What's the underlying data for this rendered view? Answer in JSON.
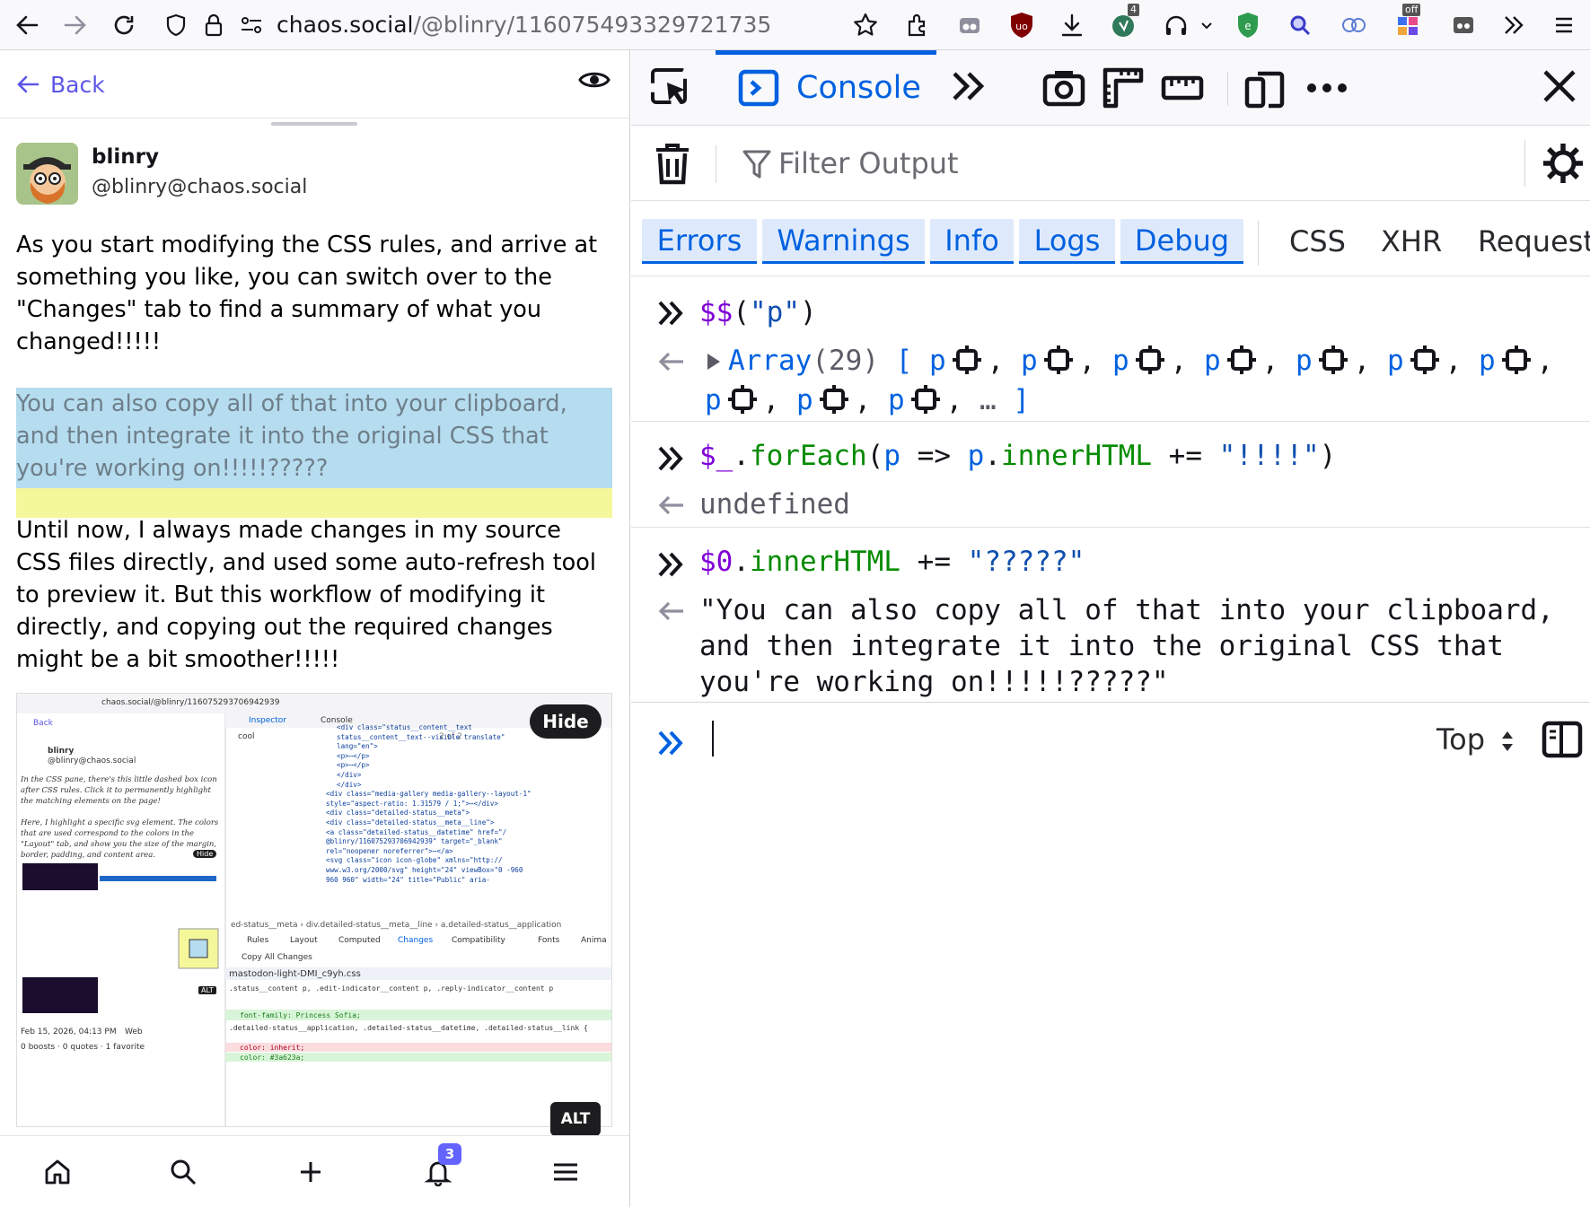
{
  "browser": {
    "url_host": "chaos.social",
    "url_path": "/@blinry/116075493329721735",
    "ext_badge_count": "4",
    "ext_badge_off": "off"
  },
  "page": {
    "back_label": "Back",
    "author": {
      "name": "blinry",
      "handle": "@blinry@chaos.social"
    },
    "paragraphs": [
      "As you start modifying the CSS rules, and arrive at something you like, you can switch over to the \"Changes\" tab to find a summary of what you changed!!!!!",
      "You can also copy all of that into your clipboard, and then integrate it into the original CSS that you're working on!!!!!?????",
      "Until now, I always made changes in my source CSS files directly, and used some auto-refresh tool to preview it. But this workflow of modifying it directly, and copying out the required changes might be a bit smoother!!!!!"
    ],
    "media": {
      "hide_label": "Hide",
      "alt_label": "ALT",
      "thumb": {
        "url": "chaos.social/@blinry/116075293706942939",
        "back": "Back",
        "author": "blinry",
        "handle": "@blinry@chaos.social",
        "p1": "In the CSS pane, there's this little dashed box icon after CSS rules. Click it to permanently highlight the matching elements on the page!",
        "p2": "Here, I highlight a specific svg element. The colors that are used correspond to the colors in the \"Layout\" tab, and show you the size of the margin, border, padding, and content area.",
        "tab_inspector": "Inspector",
        "tab_console": "Console",
        "search": "cool",
        "search_count": "2 of 2",
        "code_lines": [
          "<div class=\"status__content__text",
          "status__content__text--visible translate\"",
          "lang=\"en\">",
          "<p>⋯</p>",
          "<p>⋯</p>",
          "</div>",
          "</div>",
          "<div class=\"media-gallery media-gallery--layout-1\"",
          "style=\"aspect-ratio: 1.31579 / 1;\">⋯</div>",
          "<div class=\"detailed-status__meta\">",
          "<div class=\"detailed-status__meta__line\">",
          "<a class=\"detailed-status__datetime\" href=\"/",
          "@blinry/116075293706942939\" target=\"_blank\"",
          "rel=\"noopener noreferrer\">⋯</a>",
          "<svg class=\"icon icon-globe\" xmlns=\"http://",
          "www.w3.org/2000/svg\" height=\"24\" viewBox=\"0 -960",
          "960 960\" width=\"24\" title=\"Public\" aria-"
        ],
        "breadcrumb": "ed-status__meta  › div.detailed-status__meta__line  › a.detailed-status__application",
        "sub_tabs": [
          "Rules",
          "Layout",
          "Computed",
          "Changes",
          "Compatibility",
          "Fonts",
          "Anima"
        ],
        "copy_all": "Copy All Changes",
        "file": "mastodon-light-DMI_c9yh.css",
        "diff1_sel": ".status__content p, .edit-indicator__content p, .reply-indicator__content p",
        "diff1_add": "font-family: Princess Sofia;",
        "diff2_sel": ".detailed-status__application, .detailed-status__datetime, .detailed-status__link {",
        "diff2_del": "color: inherit;",
        "diff2_add": "color: #3a623a;",
        "date": "Feb 15, 2026, 04:13 PM",
        "visibility": "Web",
        "stats": "0 boosts · 0 quotes · 1 favorite",
        "hide": "Hide",
        "alt": "ALT"
      }
    },
    "nav": {
      "notif_count": "3"
    }
  },
  "devtools": {
    "active_tab": "Console",
    "filter_placeholder": "Filter Output",
    "levels": [
      "Errors",
      "Warnings",
      "Info",
      "Logs",
      "Debug"
    ],
    "categories": [
      "CSS",
      "XHR",
      "Request"
    ],
    "context": "Top",
    "entries": {
      "in1_fn": "$$",
      "in1_arg": "\"p\"",
      "out1_label": "Array",
      "out1_count": "(29)",
      "out1_item": "p",
      "out1_more": "…",
      "in2_var": "$_",
      "in2_method": "forEach",
      "in2_param": "p",
      "in2_arrow": "=>",
      "in2_obj": "p",
      "in2_prop": "innerHTML",
      "in2_op": "+=",
      "in2_str": "\"!!!!\"",
      "out2": "undefined",
      "in3_var": "$0",
      "in3_prop": "innerHTML",
      "in3_op": "+=",
      "in3_str": "\"?????\"",
      "out3": "\"You can also copy all of that into your clipboard, and then integrate it into the original CSS that you're working on!!!!!?????\""
    }
  },
  "colors": {
    "accent": "#0061e0",
    "mastodon": "#5d55e8",
    "highlight_content": "#b6dcef",
    "highlight_margin": "#f5f79b"
  }
}
